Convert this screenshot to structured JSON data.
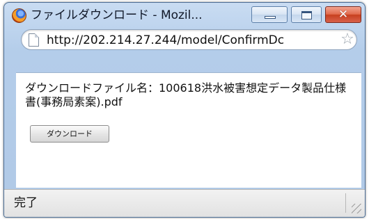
{
  "window": {
    "title": "ファイルダウンロード - Mozil..."
  },
  "url_bar": {
    "url": "http://202.214.27.244/model/ConfirmDc"
  },
  "content": {
    "filename_label": "ダウンロードファイル名：100618洪水被害想定データ製品仕様書(事務局素案).pdf",
    "download_button": "ダウンロード"
  },
  "status_bar": {
    "status": "完了"
  },
  "colors": {
    "frame": "#b0c9e6",
    "close_button": "#c7401f",
    "content_bg": "#ffffff"
  },
  "icons": {
    "app": "firefox-icon",
    "page": "page-icon",
    "bookmark": "star-icon",
    "minimize": "minimize-icon",
    "maximize": "maximize-icon",
    "close": "close-icon"
  }
}
